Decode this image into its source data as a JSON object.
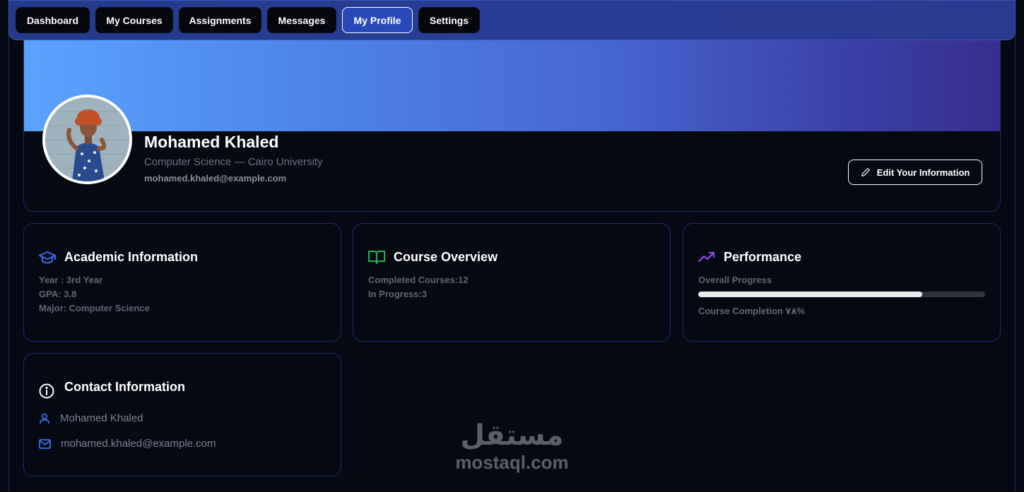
{
  "nav": {
    "items": [
      {
        "label": "Dashboard"
      },
      {
        "label": "My Courses"
      },
      {
        "label": "Assignments"
      },
      {
        "label": "Messages"
      },
      {
        "label": "My Profile"
      },
      {
        "label": "Settings"
      }
    ],
    "active": "My Profile"
  },
  "profile": {
    "name": "Mohamed Khaled",
    "subtitle": "Computer Science — Cairo University",
    "email": "mohamed.khaled@example.com",
    "edit_label": "Edit Your Information"
  },
  "academic": {
    "title": "Academic Information",
    "icon": "graduation-cap-icon",
    "year": "Year : 3rd Year",
    "gpa": "GPA: 3.8",
    "major": "Major: Computer Science"
  },
  "courses": {
    "title": "Course Overview",
    "icon": "book-open-icon",
    "completed": "Completed Courses:12",
    "in_progress": "In Progress:3"
  },
  "performance": {
    "title": "Performance",
    "icon": "trending-up-icon",
    "overall_label": "Overall Progress",
    "progress_value": 0.78,
    "completion_label": "Course Completion ٧٨%"
  },
  "contact": {
    "title": "Contact Information",
    "icon": "info-icon",
    "name": "Mohamed Khaled",
    "email": "mohamed.khaled@example.com"
  },
  "watermark": {
    "arabic": "مستقل",
    "latin": "mostaql.com"
  },
  "colors": {
    "accent_blue": "#3b6ef0",
    "book_green": "#22b35a",
    "trend_purple": "#9a4dff",
    "background": "#050912"
  }
}
